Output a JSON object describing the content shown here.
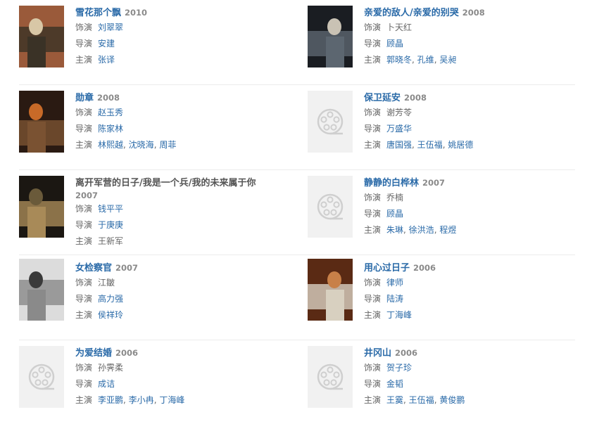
{
  "labels": {
    "actor": "饰演",
    "director": "导演",
    "starring": "主演"
  },
  "films": [
    {
      "title": "雪花那个飘",
      "year": "2010",
      "role": "刘翠翠",
      "role_link": true,
      "director": "安建",
      "director_link": true,
      "stars": [
        "张译"
      ],
      "stars_link": true,
      "poster": "photo",
      "palette": [
        "#9a5a3a",
        "#d8c7a6",
        "#3a3226"
      ]
    },
    {
      "title": "亲爱的敌人/亲爱的别哭",
      "year": "2008",
      "role": "卜天红",
      "role_link": false,
      "director": "顾晶",
      "director_link": true,
      "stars": [
        "郭晓冬",
        "孔维",
        "吴昶"
      ],
      "stars_link": true,
      "poster": "photo",
      "palette": [
        "#1a1d22",
        "#c9c2b4",
        "#5c6670"
      ]
    },
    {
      "title": "勋章",
      "year": "2008",
      "role": "赵玉秀",
      "role_link": true,
      "director": "陈家林",
      "director_link": true,
      "stars": [
        "林熙越",
        "沈晓海",
        "周菲"
      ],
      "stars_link": true,
      "poster": "photo",
      "palette": [
        "#2a1a12",
        "#c86a28",
        "#7a5232"
      ]
    },
    {
      "title": "保卫延安",
      "year": "2008",
      "role": "谢芳苓",
      "role_link": false,
      "director": "万盛华",
      "director_link": true,
      "stars": [
        "唐国强",
        "王伍福",
        "姚居德"
      ],
      "stars_link": true,
      "poster": "placeholder",
      "palette": []
    },
    {
      "title": "离开军营的日子/我是一个兵/我的未来属于你",
      "year": "2007",
      "role": "钱平平",
      "role_link": true,
      "director": "于庚庚",
      "director_link": true,
      "stars": [
        "王新军"
      ],
      "stars_link": false,
      "poster": "photo",
      "palette": [
        "#1b1712",
        "#6a5a3a",
        "#a88a58"
      ],
      "title_dark": true
    },
    {
      "title": "静静的白桦林",
      "year": "2007",
      "role": "乔楠",
      "role_link": false,
      "director": "顾晶",
      "director_link": true,
      "stars": [
        "朱琳",
        "徐洪浩",
        "程煜"
      ],
      "stars_link": true,
      "poster": "placeholder",
      "palette": []
    },
    {
      "title": "女检察官",
      "year": "2007",
      "role": "江皺",
      "role_link": false,
      "director": "高力强",
      "director_link": true,
      "stars": [
        "侯祥玲"
      ],
      "stars_link": true,
      "poster": "photo",
      "palette": [
        "#dcdcdc",
        "#3a3a3a",
        "#8a8a8a"
      ]
    },
    {
      "title": "用心过日子",
      "year": "2006",
      "role": "律师",
      "role_link": true,
      "director": "陆涛",
      "director_link": true,
      "stars": [
        "丁海峰"
      ],
      "stars_link": true,
      "poster": "photo",
      "palette": [
        "#5a2a14",
        "#c88048",
        "#d8d0c0"
      ]
    },
    {
      "title": "为爱结婚",
      "year": "2006",
      "role": "孙霁柔",
      "role_link": false,
      "director": "成诘",
      "director_link": true,
      "stars": [
        "李亚鹏",
        "李小冉",
        "丁海峰"
      ],
      "stars_link": true,
      "poster": "placeholder",
      "palette": []
    },
    {
      "title": "井冈山",
      "year": "2006",
      "role": "贺子珍",
      "role_link": true,
      "director": "金韬",
      "director_link": true,
      "stars": [
        "王霙",
        "王伍福",
        "黄俊鹏"
      ],
      "stars_link": true,
      "poster": "placeholder",
      "palette": []
    }
  ],
  "colors": {
    "link": "#2a6aa8",
    "text": "#666666",
    "year": "#8a8a8a",
    "divider": "#ececec",
    "placeholder_bg": "#f1f1f1",
    "placeholder_icon": "#cfcfcf"
  }
}
